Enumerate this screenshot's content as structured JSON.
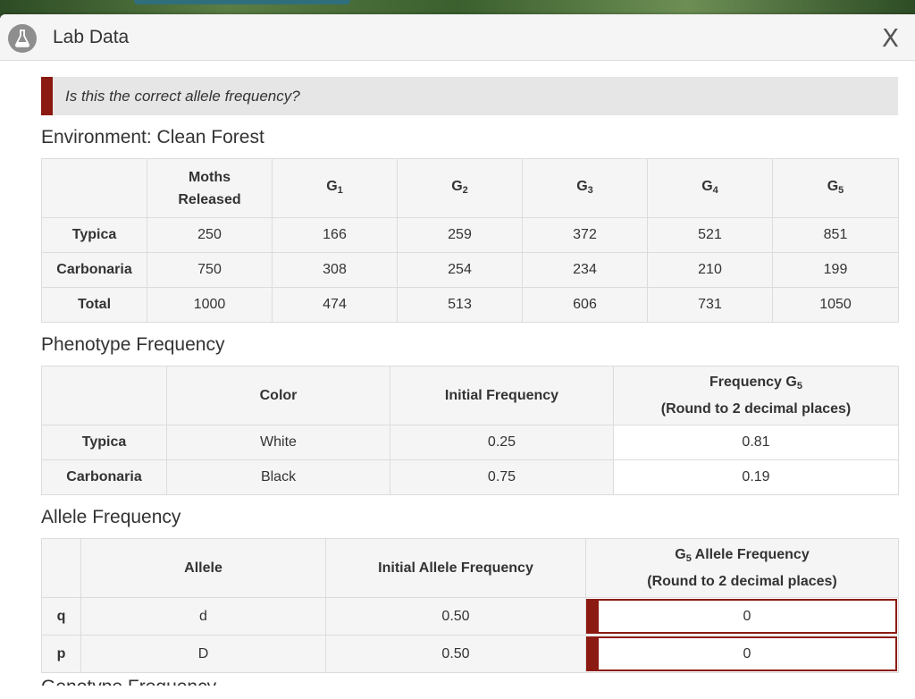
{
  "dialog": {
    "title": "Lab Data",
    "close_label": "X"
  },
  "question": "Is this the correct allele frequency?",
  "environment": {
    "title": "Environment: Clean Forest",
    "headers": [
      "Moths Released",
      "G",
      "G",
      "G",
      "G",
      "G"
    ],
    "header_subs": [
      "",
      "1",
      "2",
      "3",
      "4",
      "5"
    ],
    "rows": [
      {
        "label": "Typica",
        "values": [
          "250",
          "166",
          "259",
          "372",
          "521",
          "851"
        ]
      },
      {
        "label": "Carbonaria",
        "values": [
          "750",
          "308",
          "254",
          "234",
          "210",
          "199"
        ]
      },
      {
        "label": "Total",
        "values": [
          "1000",
          "474",
          "513",
          "606",
          "731",
          "1050"
        ]
      }
    ]
  },
  "phenotype": {
    "title": "Phenotype Frequency",
    "headers": {
      "color": "Color",
      "initial": "Initial Frequency",
      "g5_line1": "Frequency G",
      "g5_sub": "5",
      "g5_line2": "(Round to 2 decimal places)"
    },
    "rows": [
      {
        "label": "Typica",
        "color": "White",
        "initial": "0.25",
        "g5": "0.81"
      },
      {
        "label": "Carbonaria",
        "color": "Black",
        "initial": "0.75",
        "g5": "0.19"
      }
    ]
  },
  "allele": {
    "title": "Allele Frequency",
    "headers": {
      "allele": "Allele",
      "initial": "Initial Allele Frequency",
      "g5_prefix": "G",
      "g5_sub": "5",
      "g5_line1": " Allele Frequency",
      "g5_line2": "(Round to 2 decimal places)"
    },
    "rows": [
      {
        "label": "q",
        "allele": "d",
        "initial": "0.50",
        "input_value": "0"
      },
      {
        "label": "p",
        "allele": "D",
        "initial": "0.50",
        "input_value": "0"
      }
    ]
  },
  "next_section_title": "Genotype Frequency"
}
